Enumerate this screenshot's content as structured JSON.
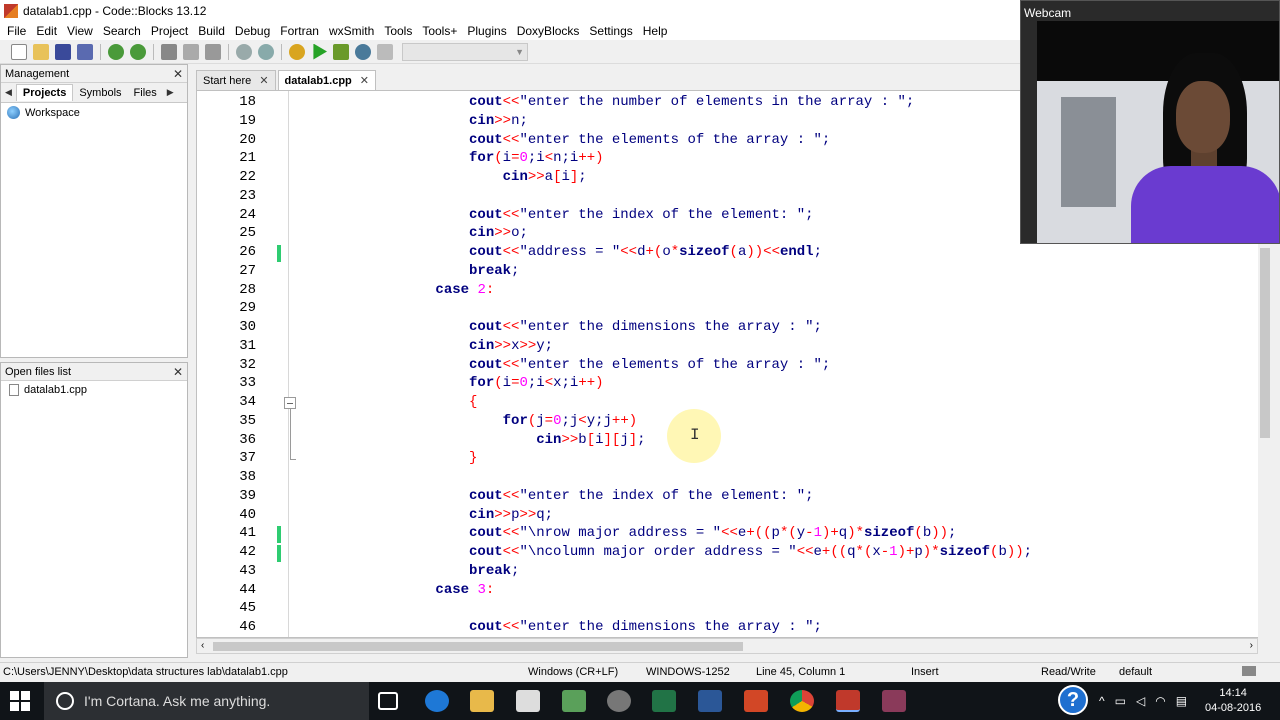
{
  "window": {
    "title": "datalab1.cpp - Code::Blocks 13.12"
  },
  "menu": [
    "File",
    "Edit",
    "View",
    "Search",
    "Project",
    "Build",
    "Debug",
    "Fortran",
    "wxSmith",
    "Tools",
    "Tools+",
    "Plugins",
    "DoxyBlocks",
    "Settings",
    "Help"
  ],
  "management": {
    "title": "Management",
    "tabs": [
      "Projects",
      "Symbols",
      "Files"
    ],
    "workspace": "Workspace"
  },
  "open_files": {
    "title": "Open files list",
    "items": [
      "datalab1.cpp"
    ]
  },
  "editor_tabs": [
    {
      "label": "Start here"
    },
    {
      "label": "datalab1.cpp"
    }
  ],
  "code": [
    {
      "n": "18",
      "html": "                    <span class=\"kw\">cout</span><span class=\"op\">&lt;&lt;</span><span class=\"str\">\"enter the number of elements in the array : \"</span>;"
    },
    {
      "n": "19",
      "html": "                    <span class=\"kw\">cin</span><span class=\"op\">&gt;&gt;</span>n;"
    },
    {
      "n": "20",
      "html": "                    <span class=\"kw\">cout</span><span class=\"op\">&lt;&lt;</span><span class=\"str\">\"enter the elements of the array : \"</span>;"
    },
    {
      "n": "21",
      "html": "                    <span class=\"kw\">for</span><span class=\"op\">(</span>i<span class=\"op\">=</span><span class=\"num\">0</span>;i<span class=\"op\">&lt;</span>n;i<span class=\"op\">++)</span>"
    },
    {
      "n": "22",
      "html": "                        <span class=\"kw\">cin</span><span class=\"op\">&gt;&gt;</span>a<span class=\"op\">[</span>i<span class=\"op\">]</span>;"
    },
    {
      "n": "23",
      "html": ""
    },
    {
      "n": "24",
      "html": "                    <span class=\"kw\">cout</span><span class=\"op\">&lt;&lt;</span><span class=\"str\">\"enter the index of the element: \"</span>;"
    },
    {
      "n": "25",
      "html": "                    <span class=\"kw\">cin</span><span class=\"op\">&gt;&gt;</span>o;"
    },
    {
      "n": "26",
      "html": "                    <span class=\"kw\">cout</span><span class=\"op\">&lt;&lt;</span><span class=\"str\">\"address = \"</span><span class=\"op\">&lt;&lt;</span>d<span class=\"op\">+(</span>o<span class=\"op\">*</span><span class=\"kw\">sizeof</span><span class=\"op\">(</span>a<span class=\"op\">))&lt;&lt;</span><span class=\"kw\">endl</span>;"
    },
    {
      "n": "27",
      "html": "                    <span class=\"kw\">break</span>;"
    },
    {
      "n": "28",
      "html": "                <span class=\"kw\">case</span> <span class=\"num\">2</span><span class=\"op\">:</span>"
    },
    {
      "n": "29",
      "html": ""
    },
    {
      "n": "30",
      "html": "                    <span class=\"kw\">cout</span><span class=\"op\">&lt;&lt;</span><span class=\"str\">\"enter the dimensions the array : \"</span>;"
    },
    {
      "n": "31",
      "html": "                    <span class=\"kw\">cin</span><span class=\"op\">&gt;&gt;</span>x<span class=\"op\">&gt;&gt;</span>y;"
    },
    {
      "n": "32",
      "html": "                    <span class=\"kw\">cout</span><span class=\"op\">&lt;&lt;</span><span class=\"str\">\"enter the elements of the array : \"</span>;"
    },
    {
      "n": "33",
      "html": "                    <span class=\"kw\">for</span><span class=\"op\">(</span>i<span class=\"op\">=</span><span class=\"num\">0</span>;i<span class=\"op\">&lt;</span>x;i<span class=\"op\">++)</span>"
    },
    {
      "n": "34",
      "html": "                    <span class=\"op\">{</span>"
    },
    {
      "n": "35",
      "html": "                        <span class=\"kw\">for</span><span class=\"op\">(</span>j<span class=\"op\">=</span><span class=\"num\">0</span>;j<span class=\"op\">&lt;</span>y;j<span class=\"op\">++)</span>"
    },
    {
      "n": "36",
      "html": "                            <span class=\"kw\">cin</span><span class=\"op\">&gt;&gt;</span>b<span class=\"op\">[</span>i<span class=\"op\">][</span>j<span class=\"op\">]</span>;"
    },
    {
      "n": "37",
      "html": "                    <span class=\"op\">}</span>"
    },
    {
      "n": "38",
      "html": ""
    },
    {
      "n": "39",
      "html": "                    <span class=\"kw\">cout</span><span class=\"op\">&lt;&lt;</span><span class=\"str\">\"enter the index of the element: \"</span>;"
    },
    {
      "n": "40",
      "html": "                    <span class=\"kw\">cin</span><span class=\"op\">&gt;&gt;</span>p<span class=\"op\">&gt;&gt;</span>q;"
    },
    {
      "n": "41",
      "html": "                    <span class=\"kw\">cout</span><span class=\"op\">&lt;&lt;</span><span class=\"str\">\"\\nrow major address = \"</span><span class=\"op\">&lt;&lt;</span>e<span class=\"op\">+((</span>p<span class=\"op\">*(</span>y<span class=\"op\">-</span><span class=\"num\">1</span><span class=\"op\">)+</span>q<span class=\"op\">)*</span><span class=\"kw\">sizeof</span><span class=\"op\">(</span>b<span class=\"op\">))</span>;"
    },
    {
      "n": "42",
      "html": "                    <span class=\"kw\">cout</span><span class=\"op\">&lt;&lt;</span><span class=\"str\">\"\\ncolumn major order address = \"</span><span class=\"op\">&lt;&lt;</span>e<span class=\"op\">+((</span>q<span class=\"op\">*(</span>x<span class=\"op\">-</span><span class=\"num\">1</span><span class=\"op\">)+</span>p<span class=\"op\">)*</span><span class=\"kw\">sizeof</span><span class=\"op\">(</span>b<span class=\"op\">))</span>;"
    },
    {
      "n": "43",
      "html": "                    <span class=\"kw\">break</span>;"
    },
    {
      "n": "44",
      "html": "                <span class=\"kw\">case</span> <span class=\"num\">3</span><span class=\"op\">:</span>"
    },
    {
      "n": "45",
      "html": ""
    },
    {
      "n": "46",
      "html": "                    <span class=\"kw\">cout</span><span class=\"op\">&lt;&lt;</span><span class=\"str\">\"enter the dimensions the array : \"</span>;"
    }
  ],
  "changed_lines": [
    "26",
    "41",
    "42"
  ],
  "status": {
    "path": "C:\\Users\\JENNY\\Desktop\\data structures lab\\datalab1.cpp",
    "eol": "Windows (CR+LF)",
    "encoding": "WINDOWS-1252",
    "position": "Line 45, Column 1",
    "mode": "Insert",
    "access": "Read/Write",
    "lang": "default"
  },
  "taskbar": {
    "search_placeholder": "I'm Cortana. Ask me anything.",
    "time": "14:14",
    "date": "04-08-2016"
  },
  "webcam": {
    "title": "Webcam"
  },
  "colors": {
    "keyword": "#00007f",
    "operator": "#ff0000",
    "number": "#ff00ff",
    "change_bar": "#2ecc71"
  }
}
